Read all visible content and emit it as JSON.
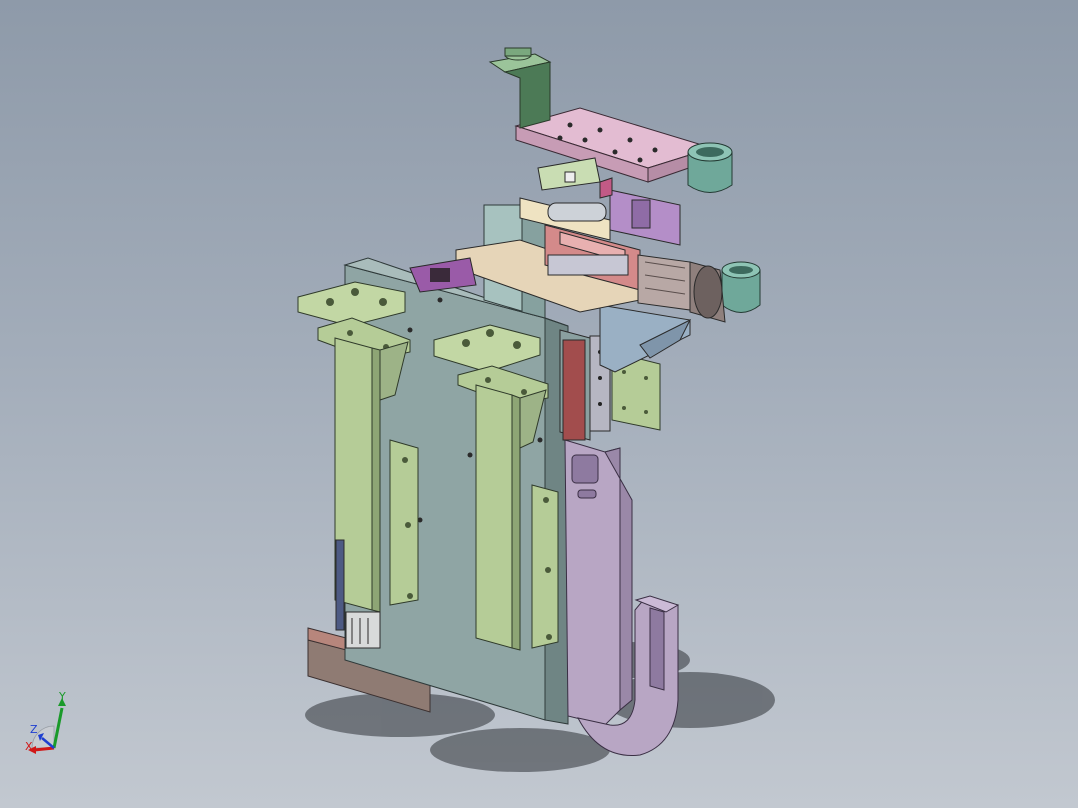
{
  "viewport": {
    "background_top": "#8e9aa9",
    "background_bottom": "#c2c8d0"
  },
  "model": {
    "description_parts": [
      "base-plate",
      "green-column-left",
      "green-column-right",
      "lavender-hook-arm",
      "pink-top-plate",
      "servo-motor",
      "cylinder-sleeves",
      "linear-guides",
      "terminal-block",
      "shadow"
    ],
    "colors": {
      "plate": "#8fa5a4",
      "column": "#b5cc97",
      "hook": "#b8a6c4",
      "top_plate": "#e3bcd2",
      "motor": "#b8a8a5",
      "sleeve": "#6fa89a",
      "guide": "#cc7f7f",
      "base": "#a88078",
      "shadow": "#2f3338"
    }
  },
  "triad": {
    "x_label": "X",
    "y_label": "Y",
    "z_label": "Z",
    "x_color": "#d01818",
    "y_color": "#1a9a2a",
    "z_color": "#1f3fd0"
  }
}
